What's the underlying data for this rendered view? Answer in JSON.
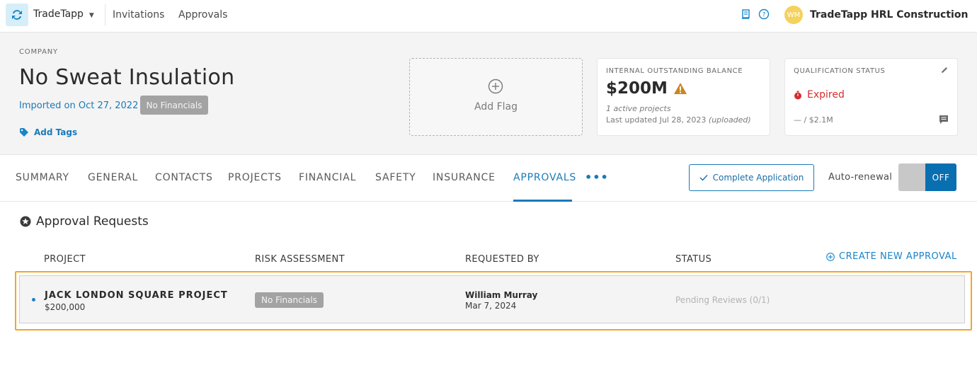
{
  "topnav": {
    "app_name": "TradeTapp",
    "links": [
      "Invitations",
      "Approvals"
    ],
    "avatar_initials": "WM",
    "org_name": "TradeTapp HRL Construction"
  },
  "company": {
    "label": "COMPANY",
    "name": "No Sweat Insulation",
    "imported": "Imported on Oct 27, 2022",
    "financials_badge": "No Financials",
    "add_tags": "Add Tags",
    "add_flag": "Add Flag"
  },
  "balance_card": {
    "label": "INTERNAL OUTSTANDING BALANCE",
    "value": "$200M",
    "active_count": "1",
    "active_text": "active projects",
    "updated": "Last updated Jul 28, 2023",
    "updated_note": "(uploaded)"
  },
  "qualification_card": {
    "label": "QUALIFICATION STATUS",
    "status": "Expired",
    "amount": "— / $2.1M"
  },
  "tabs": [
    "SUMMARY",
    "GENERAL",
    "CONTACTS",
    "PROJECTS",
    "FINANCIAL",
    "SAFETY",
    "INSURANCE",
    "APPROVALS"
  ],
  "active_tab": "APPROVALS",
  "actions": {
    "complete_application": "Complete Application",
    "auto_renewal_label": "Auto-renewal",
    "auto_renewal_state": "OFF"
  },
  "approvals": {
    "title": "Approval Requests",
    "create_label": "CREATE NEW APPROVAL",
    "columns": [
      "PROJECT",
      "RISK ASSESSMENT",
      "REQUESTED BY",
      "STATUS"
    ],
    "rows": [
      {
        "project": "JACK LONDON SQUARE PROJECT",
        "amount": "$200,000",
        "risk": "No Financials",
        "requested_by": "William Murray",
        "requested_date": "Mar 7, 2024",
        "status": "Pending Reviews (0/1)"
      }
    ]
  },
  "colors": {
    "accent": "#1a7ab8",
    "expired": "#d62d2d",
    "warning": "#c9871f",
    "highlight": "#f5a623"
  }
}
